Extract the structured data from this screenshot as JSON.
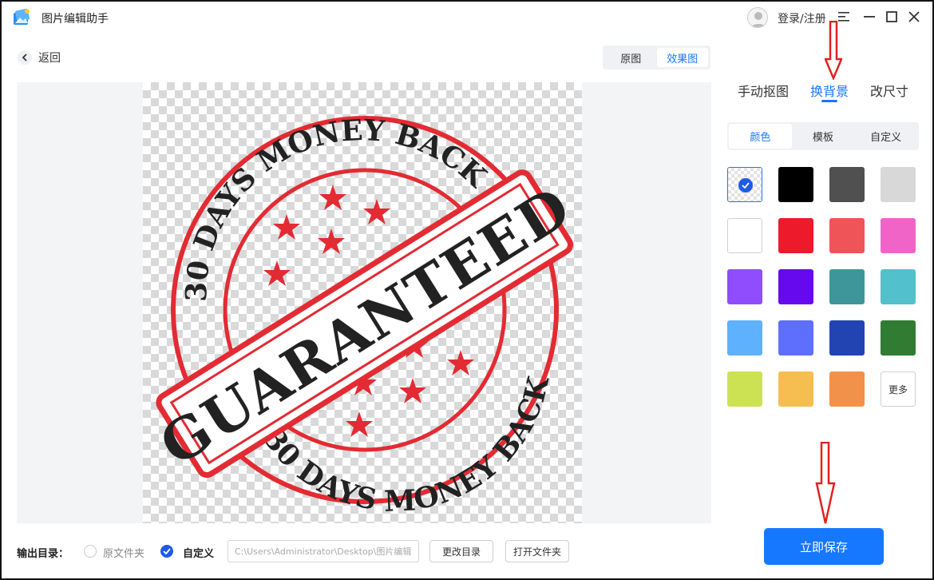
{
  "app": {
    "title": "图片编辑助手",
    "login_label": "登录/注册"
  },
  "nav": {
    "back_label": "返回"
  },
  "view_toggle": {
    "original": "原图",
    "result": "效果图",
    "active": "效果图"
  },
  "right_tabs": {
    "items": [
      "手动抠图",
      "换背景",
      "改尺寸"
    ],
    "active": "换背景"
  },
  "sub_tabs": {
    "items": [
      "颜色",
      "模板",
      "自定义"
    ],
    "active": "颜色"
  },
  "swatches": {
    "colors": [
      "transparent",
      "#000000",
      "#505050",
      "#d8d8d8",
      "#ffffff",
      "#ec1a2a",
      "#ee5458",
      "#f064c8",
      "#8f4dfd",
      "#6609ee",
      "#3e969b",
      "#52c1cb",
      "#5eb1fc",
      "#5e6ffe",
      "#2244b2",
      "#2f7c32",
      "#cde253",
      "#f6bd51",
      "#f2914a"
    ],
    "selected": "transparent",
    "more_label": "更多"
  },
  "stamp_image": {
    "top_arc": "30 DAYS MONEY BACK",
    "bottom_arc": "30 DAYS MONEY BACK",
    "banner": "GUARANTEED",
    "colors": {
      "red": "#e32b33",
      "ink": "#222222"
    }
  },
  "output": {
    "label": "输出目录：",
    "option_original": "原文件夹",
    "option_custom": "自定义",
    "selected": "自定义",
    "path_value": "C:\\Users\\Administrator\\Desktop\\图片编辑",
    "change_dir_label": "更改目录",
    "open_folder_label": "打开文件夹"
  },
  "save_label": "立即保存",
  "accent": "#1677ff",
  "annotation_color": "#e0221f"
}
